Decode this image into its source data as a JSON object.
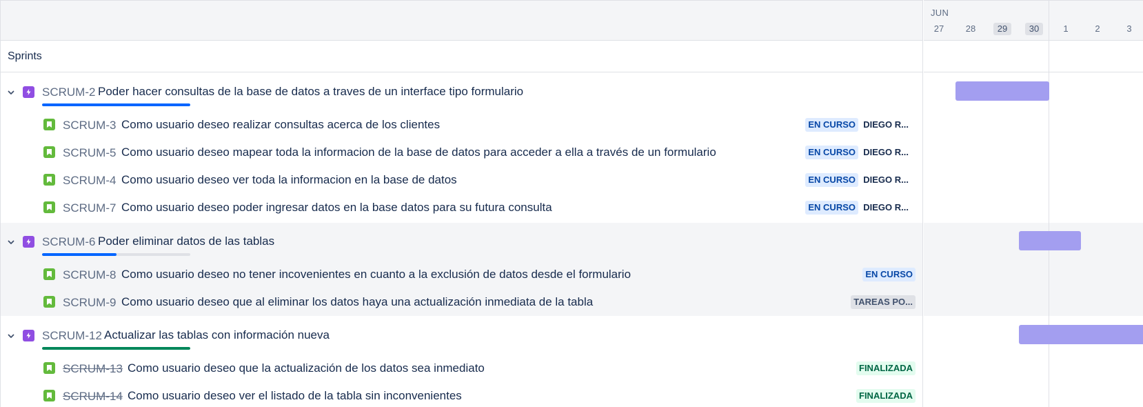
{
  "header": {
    "month": "JUN",
    "days": [
      {
        "label": "27",
        "highlight": false
      },
      {
        "label": "28",
        "highlight": false
      },
      {
        "label": "29",
        "highlight": true
      },
      {
        "label": "30",
        "highlight": true
      },
      {
        "label": "1",
        "highlight": false
      },
      {
        "label": "2",
        "highlight": false
      },
      {
        "label": "3",
        "highlight": false
      }
    ]
  },
  "sprints_label": "Sprints",
  "epics": [
    {
      "key": "SCRUM-2",
      "title": "Poder hacer consultas de la base de datos a traves de un interface tipo formulario",
      "progress_done": 1.0,
      "progress_inprogress": 0.0,
      "progress_color": "#0065ff",
      "children": [
        {
          "key": "SCRUM-3",
          "title": "Como usuario deseo realizar consultas acerca de los clientes",
          "status": "EN CURSO",
          "status_type": "inprogress",
          "assignee": "DIEGO R...",
          "done": false
        },
        {
          "key": "SCRUM-5",
          "title": "Como usuario deseo mapear toda la informacion de la base de datos para acceder a ella a través de un formulario",
          "status": "EN CURSO",
          "status_type": "inprogress",
          "assignee": "DIEGO R...",
          "done": false
        },
        {
          "key": "SCRUM-4",
          "title": "Como usuario deseo ver toda la informacion en la base de datos",
          "status": "EN CURSO",
          "status_type": "inprogress",
          "assignee": "DIEGO R...",
          "done": false
        },
        {
          "key": "SCRUM-7",
          "title": "Como usuario deseo poder ingresar datos en la base datos para su futura consulta",
          "status": "EN CURSO",
          "status_type": "inprogress",
          "assignee": "DIEGO R...",
          "done": false
        }
      ]
    },
    {
      "key": "SCRUM-6",
      "title": "Poder eliminar datos de las tablas",
      "progress_done": 0.5,
      "progress_inprogress": 0.0,
      "progress_color": "#0065ff",
      "children": [
        {
          "key": "SCRUM-8",
          "title": "Como usuario deseo no tener incovenientes en cuanto a la exclusión de datos desde el formulario",
          "status": "EN CURSO",
          "status_type": "inprogress",
          "assignee": "",
          "done": false
        },
        {
          "key": "SCRUM-9",
          "title": "Como usuario deseo que al eliminar los datos haya una actualización inmediata de la tabla",
          "status": "TAREAS PO...",
          "status_type": "todo",
          "assignee": "",
          "done": false
        }
      ]
    },
    {
      "key": "SCRUM-12",
      "title": "Actualizar las tablas con información nueva",
      "progress_done": 1.0,
      "progress_inprogress": 0.0,
      "progress_color": "#00875a",
      "children": [
        {
          "key": "SCRUM-13",
          "title": "Como usuario deseo que la actualización de los datos sea inmediato",
          "status": "FINALIZADA",
          "status_type": "done",
          "assignee": "",
          "done": true
        },
        {
          "key": "SCRUM-14",
          "title": "Como usuario deseo ver el listado de la tabla sin inconvenientes",
          "status": "FINALIZADA",
          "status_type": "done",
          "assignee": "",
          "done": true
        }
      ]
    }
  ],
  "colors": {
    "epic": "#904ee2",
    "story": "#63ba3c",
    "timeline_bar": "#a39ef0"
  }
}
